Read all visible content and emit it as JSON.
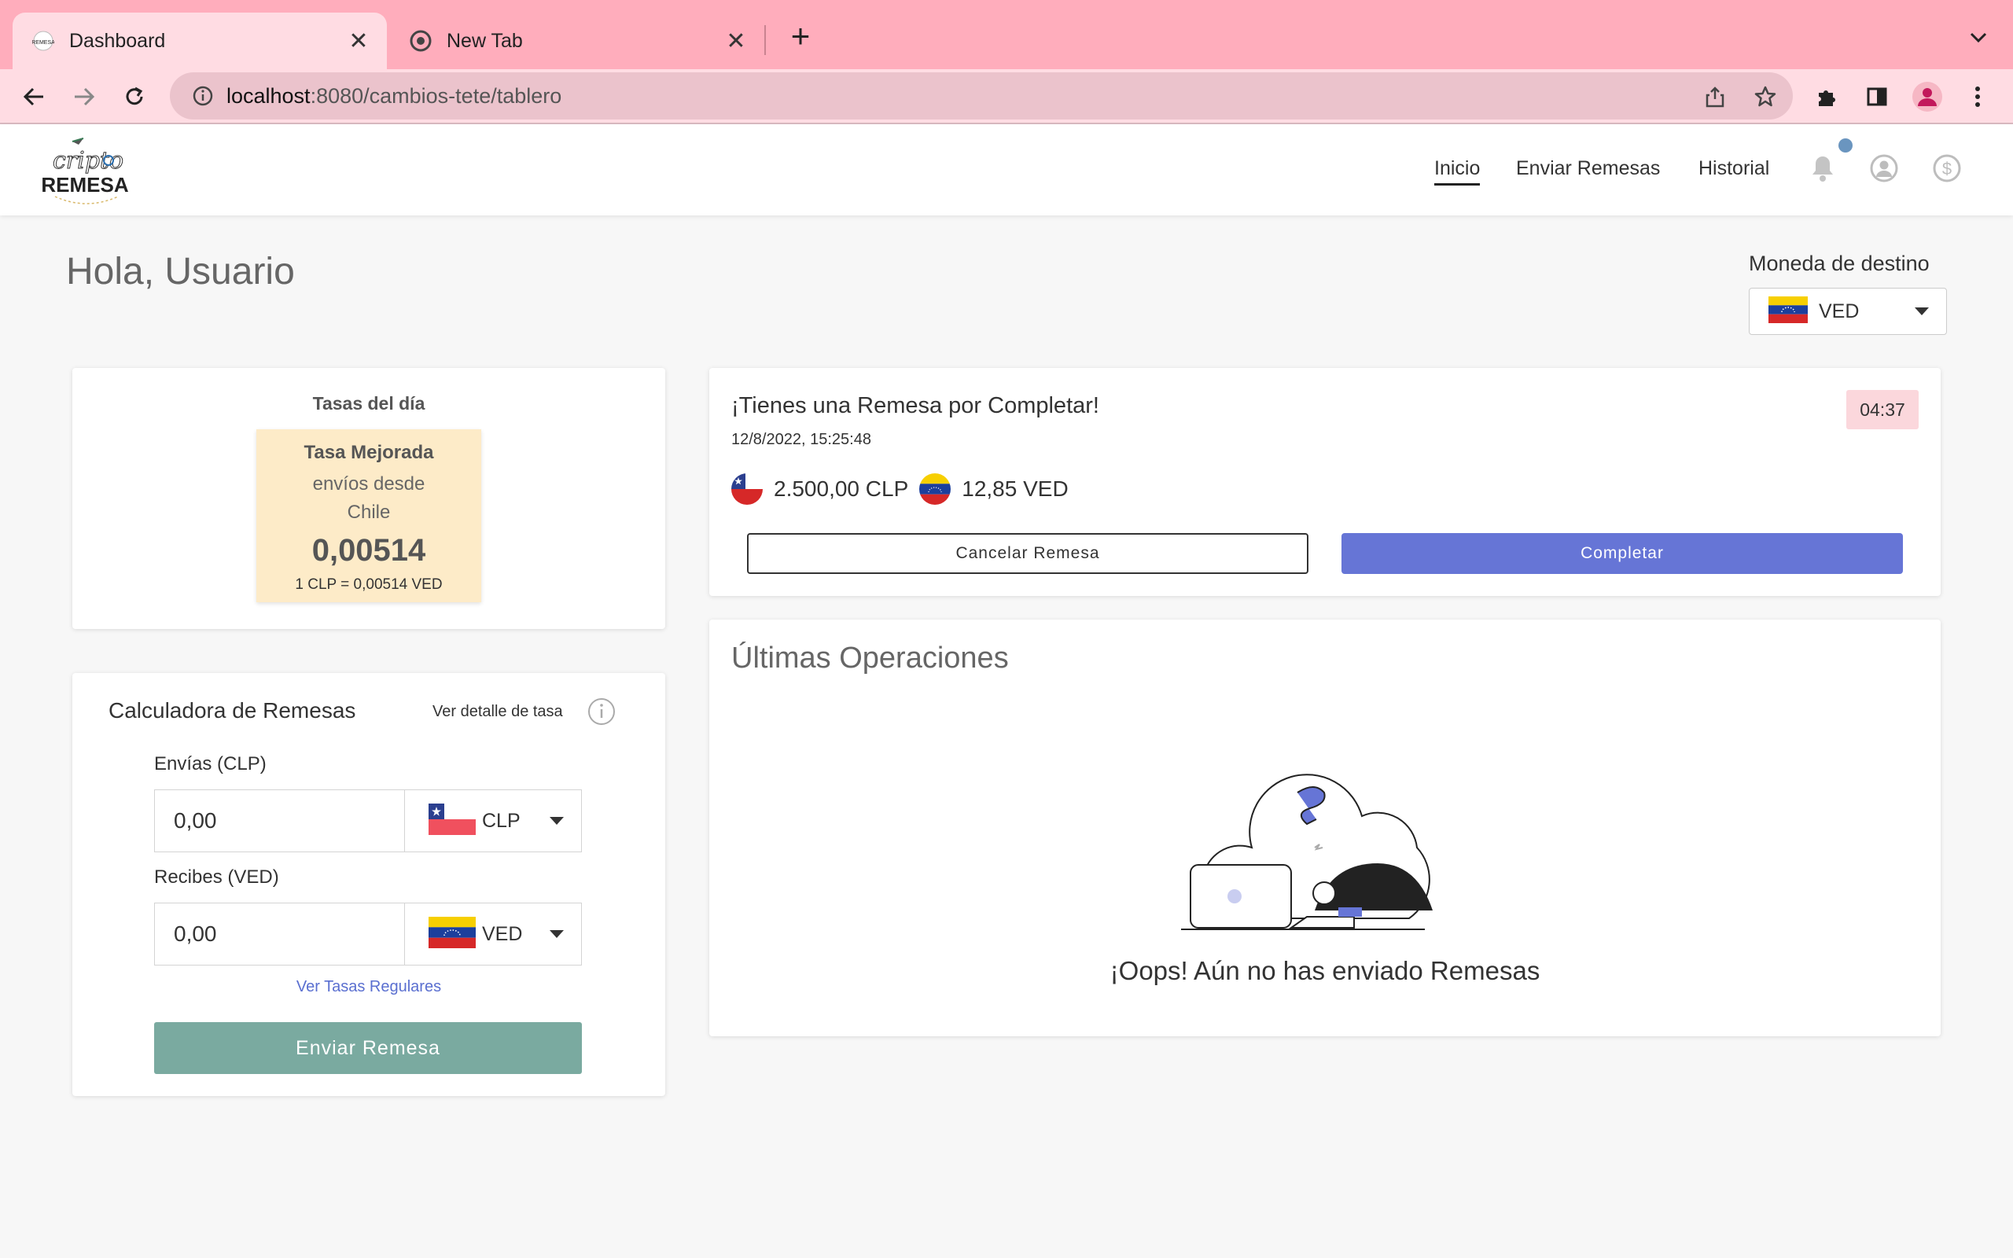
{
  "browser": {
    "tabs": [
      {
        "title": "Dashboard",
        "active": true
      },
      {
        "title": "New Tab",
        "active": false
      }
    ],
    "url_host": "localhost",
    "url_rest": ":8080/cambios-tete/tablero"
  },
  "navbar": {
    "logo_top": "cripto",
    "logo_bottom": "REMESA",
    "links": [
      {
        "label": "Inicio",
        "active": true
      },
      {
        "label": "Enviar Remesas",
        "active": false
      },
      {
        "label": "Historial",
        "active": false
      }
    ]
  },
  "page": {
    "greeting": "Hola, Usuario",
    "destination": {
      "label": "Moneda de destino",
      "currency": "VED"
    }
  },
  "rates": {
    "title": "Tasas del día",
    "box_title": "Tasa Mejorada",
    "box_line1": "envíos desde",
    "box_line2": "Chile",
    "value": "0,00514",
    "equivalence": "1 CLP = 0,00514 VED"
  },
  "calculator": {
    "title": "Calculadora de Remesas",
    "detail_link": "Ver detalle de tasa",
    "send_label": "Envías (CLP)",
    "send_value": "0,00",
    "send_currency": "CLP",
    "receive_label": "Recibes (VED)",
    "receive_value": "0,00",
    "receive_currency": "VED",
    "regular_link": "Ver Tasas Regulares",
    "submit": "Enviar Remesa"
  },
  "pending": {
    "title": "¡Tienes una Remesa por Completar!",
    "date": "12/8/2022, 15:25:48",
    "timer": "04:37",
    "send_amount": "2.500,00 CLP",
    "receive_amount": "12,85 VED",
    "cancel": "Cancelar Remesa",
    "complete": "Completar"
  },
  "operations": {
    "title": "Últimas Operaciones",
    "empty": "¡Oops! Aún no has enviado Remesas"
  },
  "colors": {
    "tabstrip": "#ffadbc",
    "toolbar": "#ffdce3",
    "complete_button": "#6675d6",
    "send_button": "#7aaaa0",
    "rate_box": "#fdebc8",
    "timer_badge": "#fbd7dc"
  },
  "icons": [
    "back-icon",
    "forward-icon",
    "reload-icon",
    "info-icon",
    "share-icon",
    "star-icon",
    "puzzle-icon",
    "sidepanel-icon",
    "profile-icon",
    "menu-icon",
    "bell-icon",
    "user-icon",
    "dollar-icon",
    "chile-flag-icon",
    "venezuela-flag-icon"
  ]
}
